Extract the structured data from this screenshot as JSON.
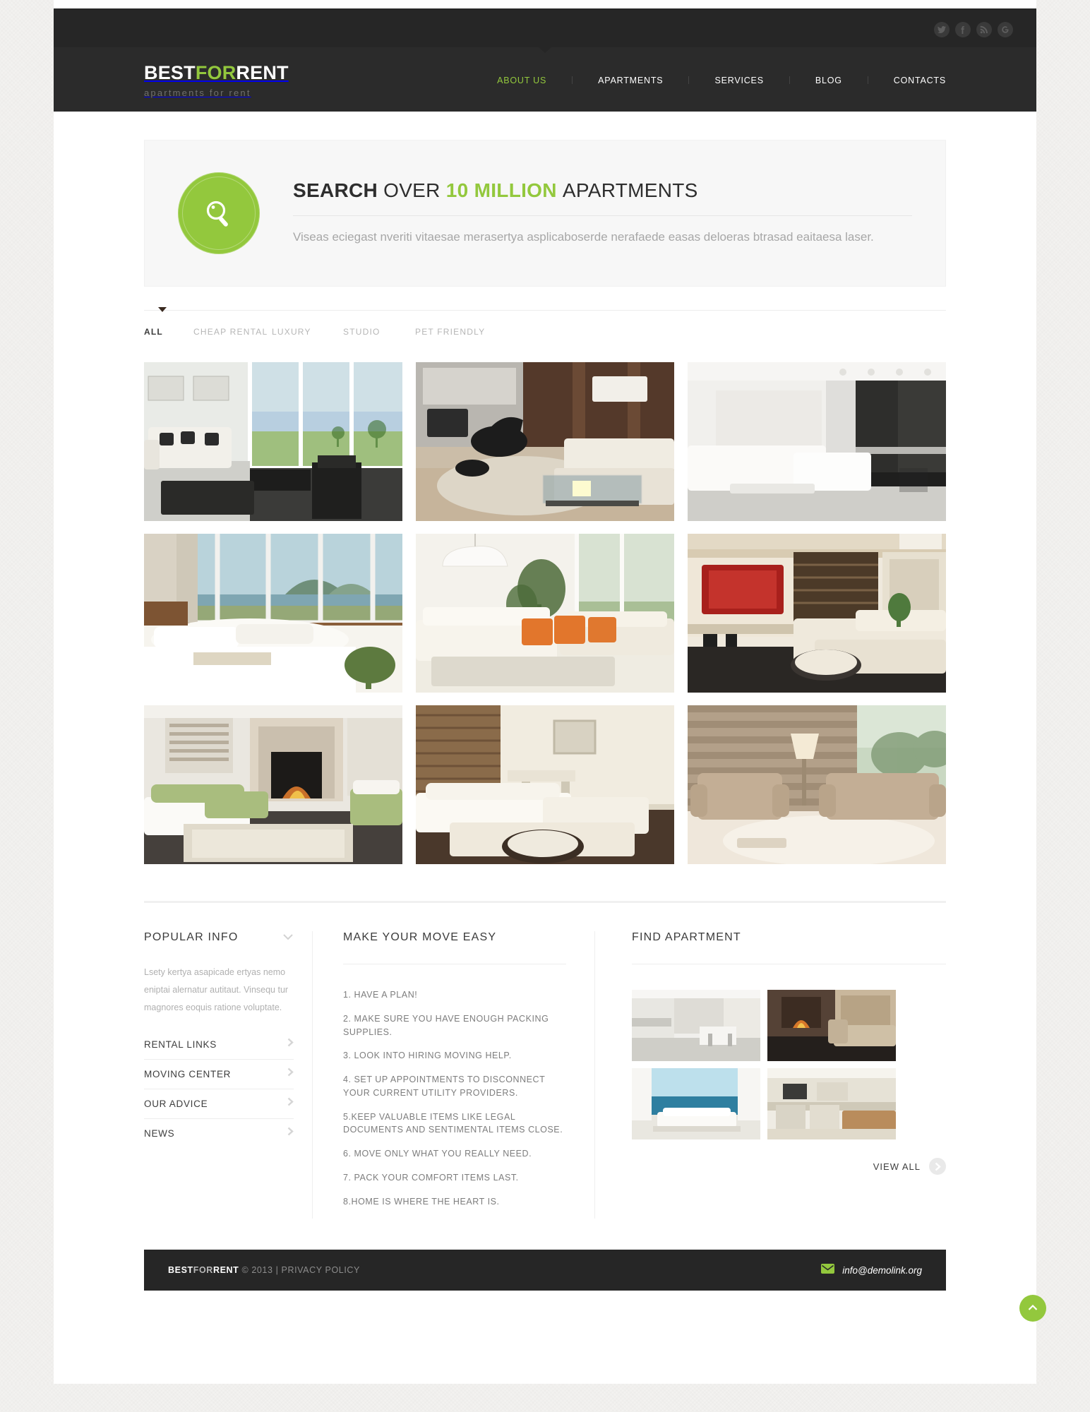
{
  "brand": {
    "name_part1": "BEST",
    "name_part2": "FOR",
    "name_part3": "RENT",
    "tagline": "apartments for rent",
    "accent_color": "#93c83d",
    "dark_color": "#262626"
  },
  "topbar": {
    "social": [
      {
        "name": "twitter-icon",
        "label": "Twitter"
      },
      {
        "name": "facebook-icon",
        "label": "Facebook"
      },
      {
        "name": "rss-icon",
        "label": "RSS"
      },
      {
        "name": "google-plus-icon",
        "label": "Google Plus"
      }
    ]
  },
  "nav": {
    "items": [
      {
        "label": "ABOUT US",
        "active": true
      },
      {
        "label": "APARTMENTS",
        "active": false
      },
      {
        "label": "SERVICES",
        "active": false
      },
      {
        "label": "BLOG",
        "active": false
      },
      {
        "label": "CONTACTS",
        "active": false
      }
    ]
  },
  "hero": {
    "icon": "search-magnifier-icon",
    "title_1": "SEARCH ",
    "title_2": "OVER ",
    "title_3": "10 MILLION ",
    "title_4": "APARTMENTS",
    "paragraph": "Viseas eciegast nveriti vitaesae merasertya asplicaboserde nerafaede easas deloeras btrasad eaitaesa laser."
  },
  "filters": {
    "tabs": [
      {
        "label": "ALL",
        "active": true
      },
      {
        "label": "CHEAP RENTAL",
        "active": false
      },
      {
        "label": "LUXURY",
        "active": false
      },
      {
        "label": "STUDIO",
        "active": false
      },
      {
        "label": "PET FRIENDLY",
        "active": false
      }
    ]
  },
  "gallery": {
    "items": [
      {
        "alt": "bright-living-room-with-garden-view",
        "c1": "#dfe3e0",
        "c2": "#9fb1a4",
        "c3": "#f2f1ee"
      },
      {
        "alt": "modern-kitchen-with-lounge-chair",
        "c1": "#5e4434",
        "c2": "#cdbfae",
        "c3": "#e8e2d8"
      },
      {
        "alt": "white-minimal-open-plan-apartment",
        "c1": "#f0f0ee",
        "c2": "#cfcfcb",
        "c3": "#3a3a38"
      },
      {
        "alt": "seaside-bedroom-with-panoramic-window",
        "c1": "#bcd0d6",
        "c2": "#e7e2d8",
        "c3": "#7d5a3c"
      },
      {
        "alt": "white-sofa-with-orange-cushions",
        "c1": "#f3f0e8",
        "c2": "#e2762c",
        "c3": "#cdd6c6"
      },
      {
        "alt": "lounge-with-red-tv-wall-and-corner-sofa",
        "c1": "#eee8dc",
        "c2": "#b1241f",
        "c3": "#2d2a28"
      },
      {
        "alt": "living-room-with-stone-fireplace",
        "c1": "#e6e4dd",
        "c2": "#a9bd7e",
        "c3": "#4a4441"
      },
      {
        "alt": "white-corner-sofa-with-blinds",
        "c1": "#f4f1e9",
        "c2": "#d8cdb9",
        "c3": "#4a382b"
      },
      {
        "alt": "brick-wall-lounge-with-armchairs",
        "c1": "#d8c6b2",
        "c2": "#b59c82",
        "c3": "#8d7e6e"
      }
    ]
  },
  "footer": {
    "popular": {
      "heading": "POPULAR INFO",
      "chevron": "chevron-down-icon",
      "paragraph": "Lsety kertya asapicade ertyas nemo eniptai alernatur autitaut. Vinsequ tur magnores eoquis ratione voluptate.",
      "links": [
        {
          "label": "RENTAL LINKS"
        },
        {
          "label": "MOVING CENTER"
        },
        {
          "label": "OUR ADVICE"
        },
        {
          "label": "NEWS"
        }
      ]
    },
    "move": {
      "heading": "MAKE YOUR MOVE EASY",
      "steps": [
        "1. HAVE A PLAN!",
        "2. MAKE SURE YOU HAVE ENOUGH PACKING SUPPLIES.",
        "3. LOOK INTO HIRING MOVING HELP.",
        "4. SET UP APPOINTMENTS TO DISCONNECT YOUR CURRENT UTILITY PROVIDERS.",
        "5.KEEP VALUABLE ITEMS LIKE LEGAL DOCUMENTS AND SENTIMENTAL ITEMS CLOSE.",
        "6. MOVE ONLY WHAT YOU REALLY NEED.",
        "7. PACK YOUR COMFORT ITEMS LAST.",
        "8.HOME IS WHERE THE HEART IS."
      ]
    },
    "find": {
      "heading": "FIND APARTMENT",
      "view_all": "VIEW ALL",
      "thumbs": [
        {
          "alt": "white-kitchen-thumb",
          "c1": "#f1f1ef",
          "c2": "#d6d6d2",
          "c3": "#8e8e8a"
        },
        {
          "alt": "fireplace-lounge-thumb",
          "c1": "#4a3a30",
          "c2": "#c9b79c",
          "c3": "#2b2522"
        },
        {
          "alt": "sea-view-terrace-thumb",
          "c1": "#9fd2e4",
          "c2": "#f4f4f2",
          "c3": "#2b6f8c"
        },
        {
          "alt": "kitchen-with-table-thumb",
          "c1": "#efece4",
          "c2": "#b98c5c",
          "c3": "#d9d4c9"
        }
      ]
    }
  },
  "bottombar": {
    "copyright_brand_1": "BEST",
    "copyright_brand_2": "FOR",
    "copyright_brand_3": "RENT",
    "copyright_rest": " © 2013  |  PRIVACY POLICY",
    "email": "info@demolink.org",
    "email_icon": "envelope-icon"
  },
  "totop": {
    "icon": "arrow-up-icon"
  }
}
